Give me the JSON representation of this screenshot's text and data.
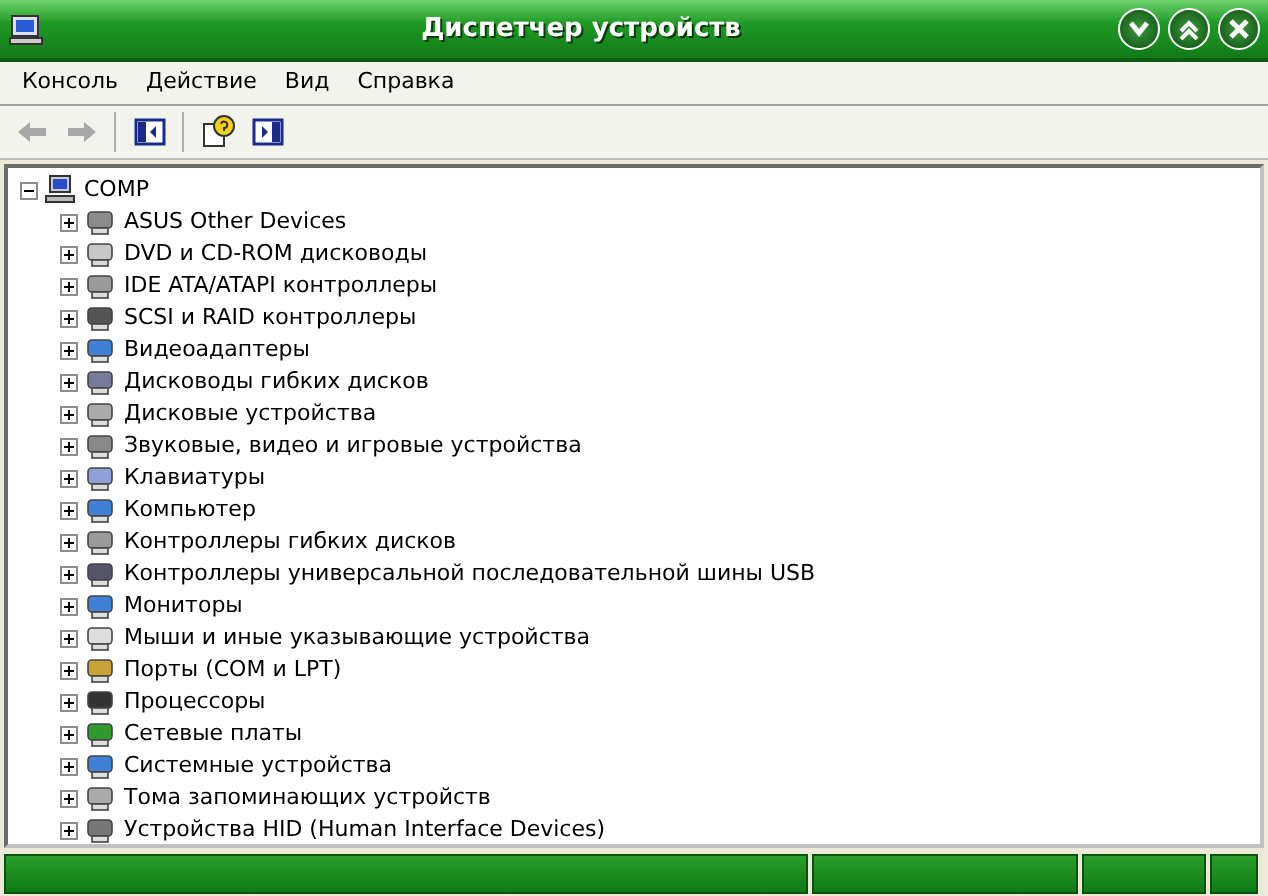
{
  "window": {
    "title": "Диспетчер устройств"
  },
  "menu": [
    {
      "label": "Консоль"
    },
    {
      "label": "Действие"
    },
    {
      "label": "Вид"
    },
    {
      "label": "Справка"
    }
  ],
  "toolbar": [
    {
      "kind": "back",
      "disabled": true
    },
    {
      "kind": "forward",
      "disabled": true
    },
    {
      "kind": "separator"
    },
    {
      "kind": "tree",
      "disabled": false
    },
    {
      "kind": "separator"
    },
    {
      "kind": "help",
      "disabled": false
    },
    {
      "kind": "pane",
      "disabled": false
    }
  ],
  "tree": {
    "label": "COMP",
    "expanded": true,
    "children": [
      {
        "label": "ASUS Other Devices",
        "expanded": false
      },
      {
        "label": "DVD и CD-ROM дисководы",
        "expanded": false
      },
      {
        "label": "IDE ATA/ATAPI контроллеры",
        "expanded": false
      },
      {
        "label": "SCSI и RAID контроллеры",
        "expanded": false
      },
      {
        "label": "Видеоадаптеры",
        "expanded": false
      },
      {
        "label": "Дисководы гибких дисков",
        "expanded": false
      },
      {
        "label": "Дисковые устройства",
        "expanded": false
      },
      {
        "label": "Звуковые, видео и игровые устройства",
        "expanded": false
      },
      {
        "label": "Клавиатуры",
        "expanded": false
      },
      {
        "label": "Компьютер",
        "expanded": false
      },
      {
        "label": "Контроллеры гибких дисков",
        "expanded": false
      },
      {
        "label": "Контроллеры универсальной последовательной шины USB",
        "expanded": false
      },
      {
        "label": "Мониторы",
        "expanded": false
      },
      {
        "label": "Мыши и иные указывающие устройства",
        "expanded": false
      },
      {
        "label": "Порты (COM и LPT)",
        "expanded": false
      },
      {
        "label": "Процессоры",
        "expanded": false
      },
      {
        "label": "Сетевые платы",
        "expanded": false
      },
      {
        "label": "Системные устройства",
        "expanded": false
      },
      {
        "label": "Тома запоминающих устройств",
        "expanded": false
      },
      {
        "label": "Устройства HID (Human Interface Devices)",
        "expanded": false
      }
    ]
  }
}
